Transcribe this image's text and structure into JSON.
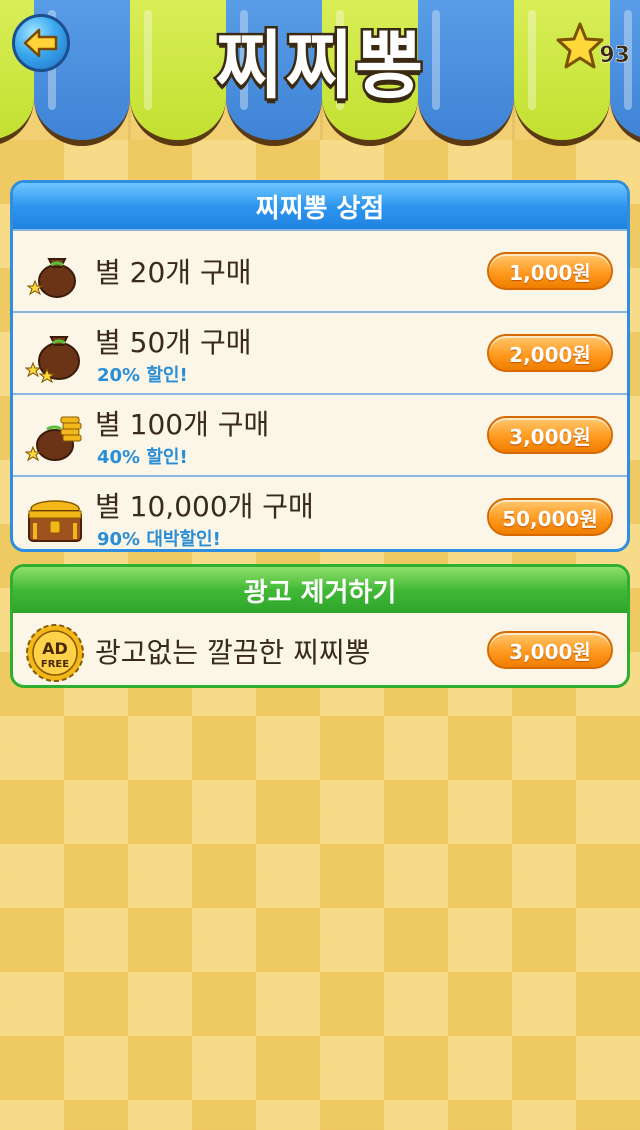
{
  "header": {
    "title": "찌찌뽕",
    "back_icon": "back-arrow-icon",
    "star_count": "93"
  },
  "shop": {
    "title": "찌찌뽕 상점",
    "items": [
      {
        "label": "별 20개 구매",
        "sub": "",
        "price": "1,000원",
        "icon": "money-bag-small-icon"
      },
      {
        "label": "별 50개 구매",
        "sub": "20% 할인!",
        "price": "2,000원",
        "icon": "money-bag-medium-icon"
      },
      {
        "label": "별 100개 구매",
        "sub": "40% 할인!",
        "price": "3,000원",
        "icon": "money-bag-coins-icon"
      },
      {
        "label": "별 10,000개 구매",
        "sub": "90% 대박할인!",
        "price": "50,000원",
        "icon": "treasure-chest-icon"
      }
    ]
  },
  "ads": {
    "title": "광고 제거하기",
    "item": {
      "label": "광고없는 깔끔한 찌찌뽕",
      "price": "3,000원",
      "badge_line1": "AD",
      "badge_line2": "FREE",
      "icon": "ad-free-badge-icon"
    }
  },
  "colors": {
    "blue_header": "#2f96ef",
    "green_header": "#42b837",
    "price_button": "#ff9a1f",
    "discount_text": "#2a8ed6"
  }
}
